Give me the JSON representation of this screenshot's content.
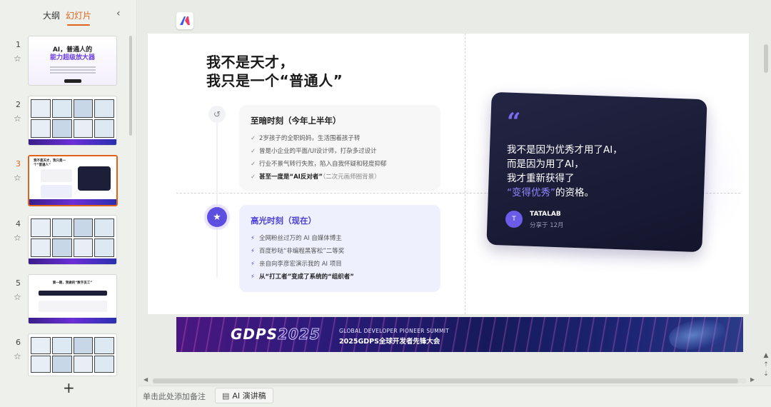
{
  "panel": {
    "tabs": [
      {
        "label": "大纲"
      },
      {
        "label": "幻灯片"
      }
    ]
  },
  "thumbnails": [
    {
      "num": "1",
      "title_line1": "AI，普通人的",
      "title_line2": "能力超级放大器"
    },
    {
      "num": "2"
    },
    {
      "num": "3",
      "title": "我不是天才，我只是一个“普通人”"
    },
    {
      "num": "4"
    },
    {
      "num": "5",
      "title": "第一期，我做的“数字员工”"
    },
    {
      "num": "6"
    }
  ],
  "slide": {
    "title_line1": "我不是天才，",
    "title_line2": "我只是一个“普通人”",
    "card1": {
      "title": "至暗时刻（今年上半年）",
      "items": [
        {
          "text": "2岁孩子的全职妈妈，生活围着孩子转"
        },
        {
          "text": "曾是小企业的平面/UI设计师，打杂多过设计"
        },
        {
          "text": "行业不景气转行失败，陷入自我怀疑和轻度抑郁"
        },
        {
          "bold": "甚至一度是“AI反对者”",
          "muted": "（二次元画师圈背景）"
        }
      ]
    },
    "card2": {
      "title": "高光时刻（现在）",
      "items": [
        {
          "text": "全网粉丝过万的 AI 自媒体博主"
        },
        {
          "text": "百度秒哒“非编程黑客松”二等奖"
        },
        {
          "text": "亲自向李彦宏演示我的 AI 项目"
        },
        {
          "bold": "从“打工者”变成了系统的“组织者”"
        }
      ]
    },
    "quote": {
      "mark": "“",
      "line1": "我不是因为优秀才用了AI，",
      "line2": "而是因为用了AI，",
      "line3": "我才重新获得了",
      "highlight": "“变得优秀”",
      "line4_rest": "的资格。",
      "avatar": "T",
      "author": "TATALAB",
      "date": "分享于 12月"
    }
  },
  "banner": {
    "logo_main": "GDPS",
    "logo_year": "2025",
    "sub1": "GLOBAL DEVELOPER PIONEER SUMMIT",
    "sub2": "2025GDPS全球开发者先锋大会"
  },
  "bottom": {
    "notes_hint": "单击此处添加备注",
    "ai_button": "AI 演讲稿"
  },
  "colors": {
    "accent": "#e0621b",
    "purple": "#5b4ee0",
    "quote_bg": "#1b1c36"
  }
}
